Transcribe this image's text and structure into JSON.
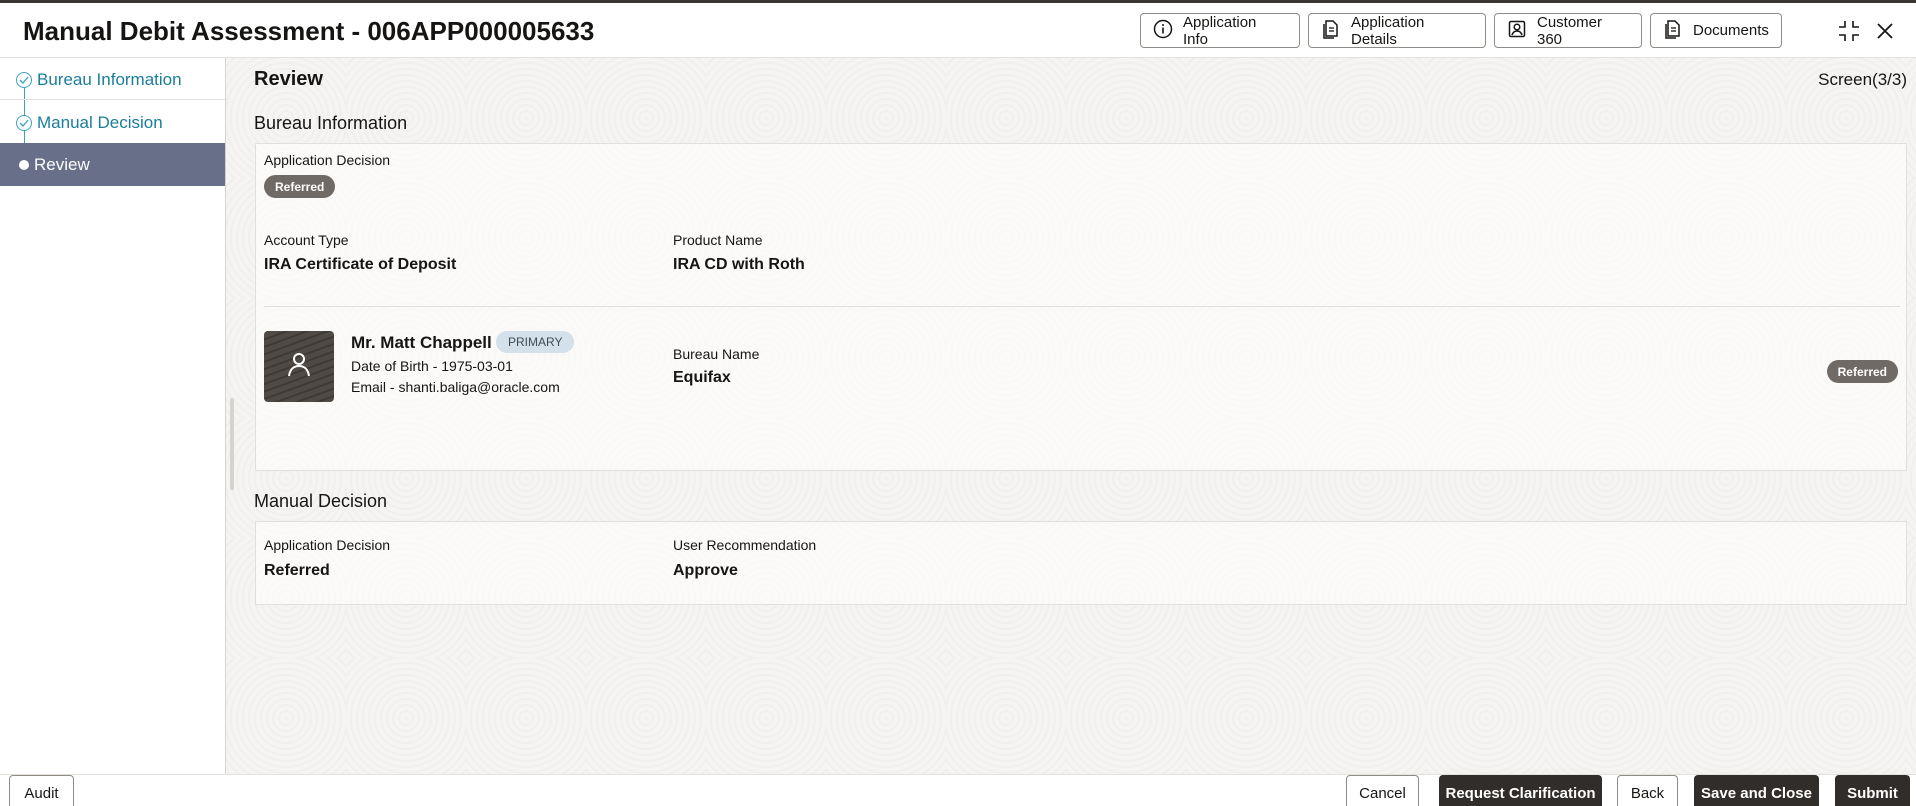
{
  "header": {
    "title": "Manual Debit Assessment - 006APP000005633",
    "buttons": {
      "application_info": "Application Info",
      "application_details": "Application Details",
      "customer_360": "Customer 360",
      "documents": "Documents"
    }
  },
  "sidebar": {
    "items": [
      {
        "label": "Bureau Information"
      },
      {
        "label": "Manual Decision"
      },
      {
        "label": "Review"
      }
    ]
  },
  "main": {
    "title": "Review",
    "screen": "Screen(3/3)",
    "bureau": {
      "section_title": "Bureau Information",
      "app_decision_label": "Application Decision",
      "app_decision_badge": "Referred",
      "account_type_label": "Account Type",
      "account_type": "IRA Certificate of Deposit",
      "product_name_label": "Product Name",
      "product_name": "IRA CD with Roth",
      "applicant": {
        "name": "Mr. Matt Chappell",
        "role": "PRIMARY",
        "dob": "Date of Birth - 1975-03-01",
        "email": "Email - shanti.baliga@oracle.com"
      },
      "bureau_name_label": "Bureau Name",
      "bureau_name": "Equifax",
      "bureau_status": "Referred"
    },
    "manual": {
      "section_title": "Manual Decision",
      "app_decision_label": "Application Decision",
      "app_decision": "Referred",
      "user_rec_label": "User Recommendation",
      "user_rec": "Approve"
    }
  },
  "footer": {
    "audit": "Audit",
    "cancel": "Cancel",
    "request_clarification": "Request Clarification",
    "back": "Back",
    "save_close": "Save and Close",
    "submit": "Submit"
  }
}
